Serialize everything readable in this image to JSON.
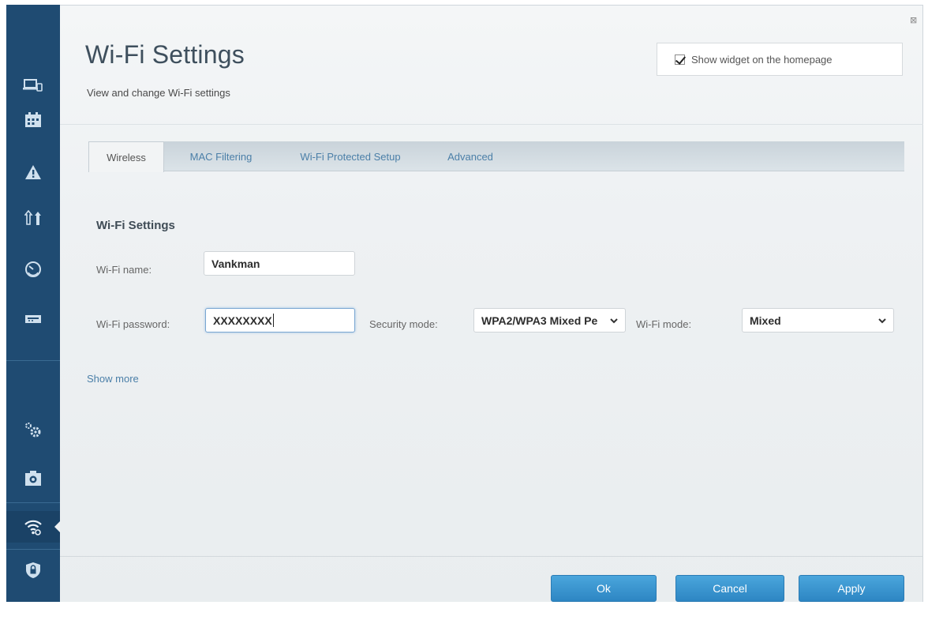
{
  "header": {
    "title": "Wi-Fi Settings",
    "subtitle": "View and change Wi-Fi settings",
    "widget_label": "Show widget on the homepage",
    "widget_checked": true,
    "close_glyph": "⊠"
  },
  "tabs": [
    {
      "label": "Wireless",
      "active": true
    },
    {
      "label": "MAC Filtering",
      "active": false
    },
    {
      "label": "Wi-Fi Protected Setup",
      "active": false
    },
    {
      "label": "Advanced",
      "active": false
    }
  ],
  "wifi": {
    "section_title": "Wi-Fi Settings",
    "name_label": "Wi-Fi name:",
    "name_value": "Vankman",
    "password_label": "Wi-Fi password:",
    "password_value": "XXXXXXXX",
    "security_label": "Security mode:",
    "security_value": "WPA2/WPA3 Mixed Pe",
    "mode_label": "Wi-Fi mode:",
    "mode_value": "Mixed",
    "show_more": "Show more"
  },
  "footer": {
    "ok_label": "Ok",
    "cancel_label": "Cancel",
    "apply_label": "Apply"
  },
  "sidebar": {
    "icons": [
      "devices-icon",
      "calendar-icon",
      "warning-icon",
      "transfer-icon",
      "speed-gauge-icon",
      "usb-storage-icon",
      "gears-icon",
      "backup-icon",
      "wifi-icon",
      "security-shield-icon"
    ],
    "active_item": "wifi-icon"
  },
  "colors": {
    "sidebar_bg": "#1f4b72",
    "accent_blue": "#2d86c3",
    "link_blue": "#4b7fa8"
  }
}
